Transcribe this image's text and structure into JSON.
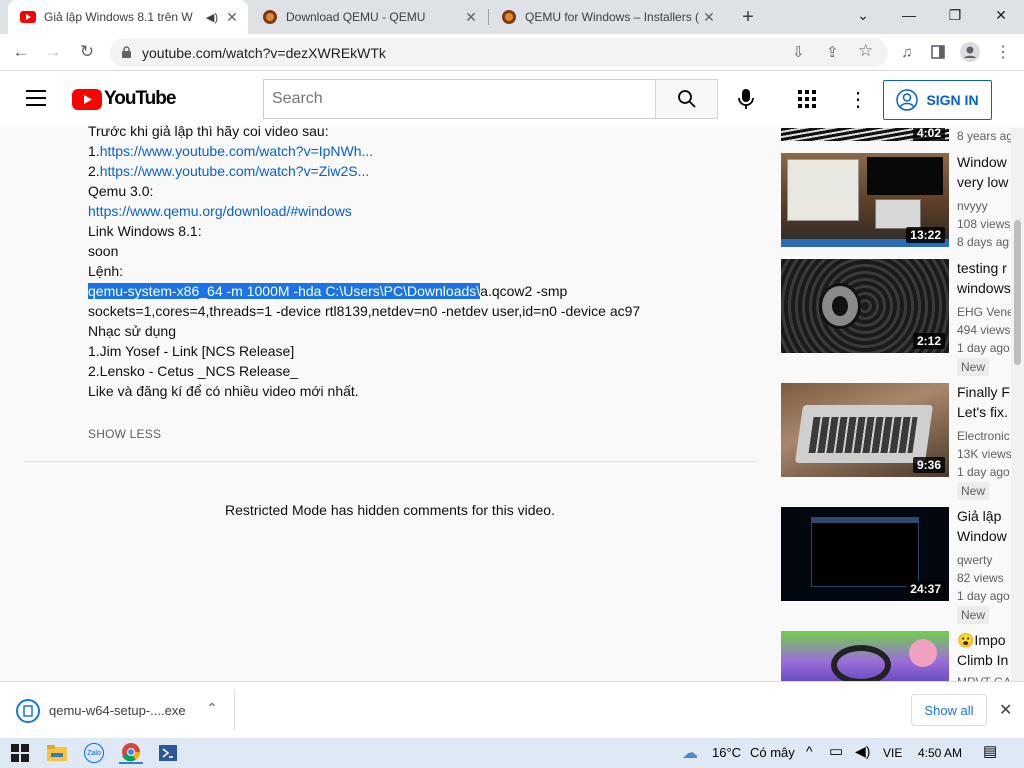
{
  "browser": {
    "tabs": [
      {
        "title": "Giả lập Windows 8.1 trên W",
        "active": true
      },
      {
        "title": "Download QEMU - QEMU",
        "active": false
      },
      {
        "title": "QEMU for Windows – Installers (",
        "active": false
      }
    ],
    "url": "youtube.com/watch?v=dezXWREkWTk"
  },
  "youtube": {
    "logo_text": "YouTube",
    "search_placeholder": "Search",
    "sign_in": "SIGN IN"
  },
  "description": {
    "lines": [
      {
        "text": "Trước khi giả lập thì hãy coi video sau:"
      },
      {
        "prefix": "1.",
        "link": "https://www.youtube.com/watch?v=IpNWh..."
      },
      {
        "prefix": "2.",
        "link": "https://www.youtube.com/watch?v=Ziw2S..."
      },
      {
        "text": "Qemu 3.0:"
      },
      {
        "link": "https://www.qemu.org/download/#windows"
      },
      {
        "text": "Link Windows 8.1:"
      },
      {
        "text": "soon"
      },
      {
        "text": "Lệnh:"
      },
      {
        "selected": "qemu-system-x86_64 -m 1000M -hda C:\\Users\\PC\\Downloads\\",
        "rest": "a.qcow2 -smp"
      },
      {
        "text": "sockets=1,cores=4,threads=1 -device rtl8139,netdev=n0 -netdev user,id=n0 -device ac97"
      },
      {
        "text": "Nhạc sử dụng"
      },
      {
        "text": "1.Jim Yosef - Link [NCS Release]"
      },
      {
        "text": "2.Lensko - Cetus _NCS Release_"
      },
      {
        "text": "Like và đăng kí để có nhiều video mới nhất."
      }
    ],
    "show_less": "SHOW LESS"
  },
  "comments": {
    "restricted": "Restricted Mode has hidden comments for this video."
  },
  "sidebar": {
    "videos": [
      {
        "title": "",
        "channel": "",
        "views": "",
        "age": "8 years ag",
        "duration": "4:02",
        "badge": ""
      },
      {
        "title": "Window",
        "title2": "very low",
        "channel": "nvyyy",
        "views": "108 views",
        "age": "8 days ag",
        "duration": "13:22",
        "badge": ""
      },
      {
        "title": "testing r",
        "title2": "windows",
        "channel": "EHG Vene",
        "views": "494 views",
        "age": "1 day ago",
        "duration": "2:12",
        "badge": "New"
      },
      {
        "title": "Finally F",
        "title2": "Let's fix.",
        "channel": "Electronic",
        "views": "13K views",
        "age": "1 day ago",
        "duration": "9:36",
        "badge": "New"
      },
      {
        "title": "Giả lập",
        "title2": "Window",
        "channel": "qwerty",
        "views": "82 views",
        "age": "1 day ago",
        "duration": "24:37",
        "badge": "New"
      },
      {
        "title": "😮Impo",
        "title2": "Climb In",
        "channel": "MRVT GA",
        "views": "",
        "age": "",
        "duration": "",
        "badge": ""
      }
    ]
  },
  "downloads": {
    "file": "qemu-w64-setup-....exe",
    "show_all": "Show all"
  },
  "taskbar": {
    "temperature": "16°C",
    "weather": "Có mây",
    "lang": "VIE",
    "time": "4:50 AM",
    "zalo_label": "Zalo"
  }
}
